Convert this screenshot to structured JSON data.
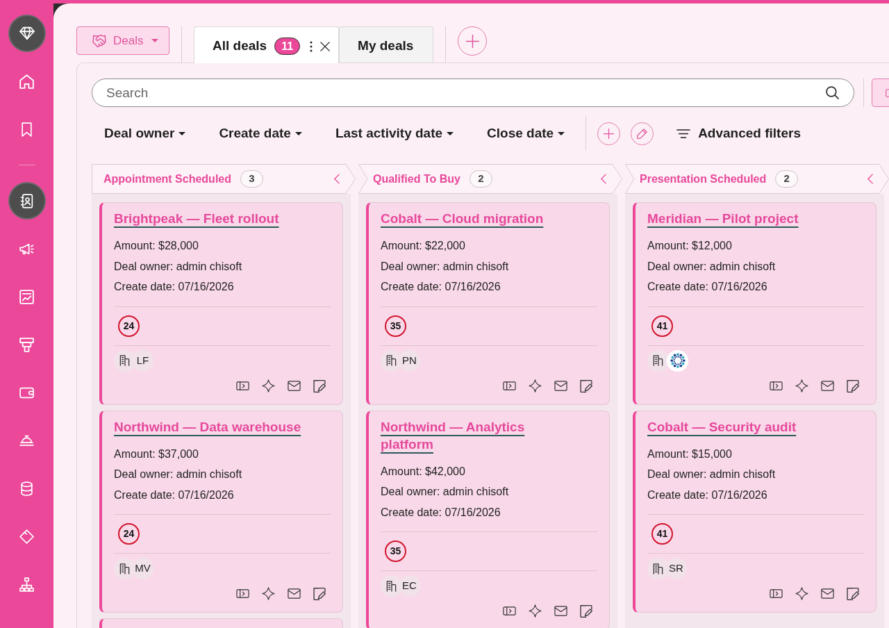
{
  "sidebar": {
    "groups": [
      {
        "items": [
          {
            "selected": false
          },
          {
            "selected": false
          }
        ]
      },
      {
        "items": [
          {
            "selected": true
          },
          {
            "selected": false
          },
          {
            "selected": false
          },
          {
            "selected": false
          },
          {
            "selected": false
          },
          {
            "selected": false
          },
          {
            "selected": false
          },
          {
            "selected": false
          },
          {
            "selected": false
          }
        ]
      }
    ]
  },
  "module_menu": {
    "label": "Deals"
  },
  "tabs": [
    {
      "label": "All deals",
      "count": "11",
      "selected": true
    },
    {
      "label": "My deals",
      "selected": false
    }
  ],
  "search": {
    "placeholder": "Search"
  },
  "filters": [
    {
      "label": "Deal owner"
    },
    {
      "label": "Create date"
    },
    {
      "label": "Last activity date"
    },
    {
      "label": "Close date"
    }
  ],
  "advanced_filters": {
    "label": "Advanced filters"
  },
  "columns": [
    {
      "title": "Appointment Scheduled",
      "count": "3",
      "has_more": true,
      "deals": [
        {
          "title": "Brightpeak — Fleet rollout",
          "fields": [
            "Amount: $28,000",
            "Deal owner: admin chisoft",
            "Create date: 07/16/2026"
          ],
          "score": "24",
          "contact": {
            "kind": "initials",
            "initials": "LF"
          }
        },
        {
          "title": "Northwind — Data warehouse",
          "fields": [
            "Amount: $37,000",
            "Deal owner: admin chisoft",
            "Create date: 07/16/2026"
          ],
          "score": "24",
          "contact": {
            "kind": "initials",
            "initials": "MV"
          }
        }
      ]
    },
    {
      "title": "Qualified To Buy",
      "count": "2",
      "has_more": false,
      "deals": [
        {
          "title": "Cobalt — Cloud migration",
          "fields": [
            "Amount: $22,000",
            "Deal owner: admin chisoft",
            "Create date: 07/16/2026"
          ],
          "score": "35",
          "contact": {
            "kind": "initials",
            "initials": "PN"
          }
        },
        {
          "title": "Northwind — Analytics platform",
          "fields": [
            "Amount: $42,000",
            "Deal owner: admin chisoft",
            "Create date: 07/16/2026"
          ],
          "score": "35",
          "contact": {
            "kind": "initials",
            "initials": "EC"
          }
        }
      ]
    },
    {
      "title": "Presentation Scheduled",
      "count": "2",
      "has_more": false,
      "deals": [
        {
          "title": "Meridian — Pilot project",
          "fields": [
            "Amount: $12,000",
            "Deal owner: admin chisoft",
            "Create date: 07/16/2026"
          ],
          "score": "41",
          "contact": {
            "kind": "logo"
          }
        },
        {
          "title": "Cobalt — Security audit",
          "fields": [
            "Amount: $15,000",
            "Deal owner: admin chisoft",
            "Create date: 07/16/2026"
          ],
          "score": "41",
          "contact": {
            "kind": "initials",
            "initials": "SR"
          }
        }
      ]
    }
  ]
}
